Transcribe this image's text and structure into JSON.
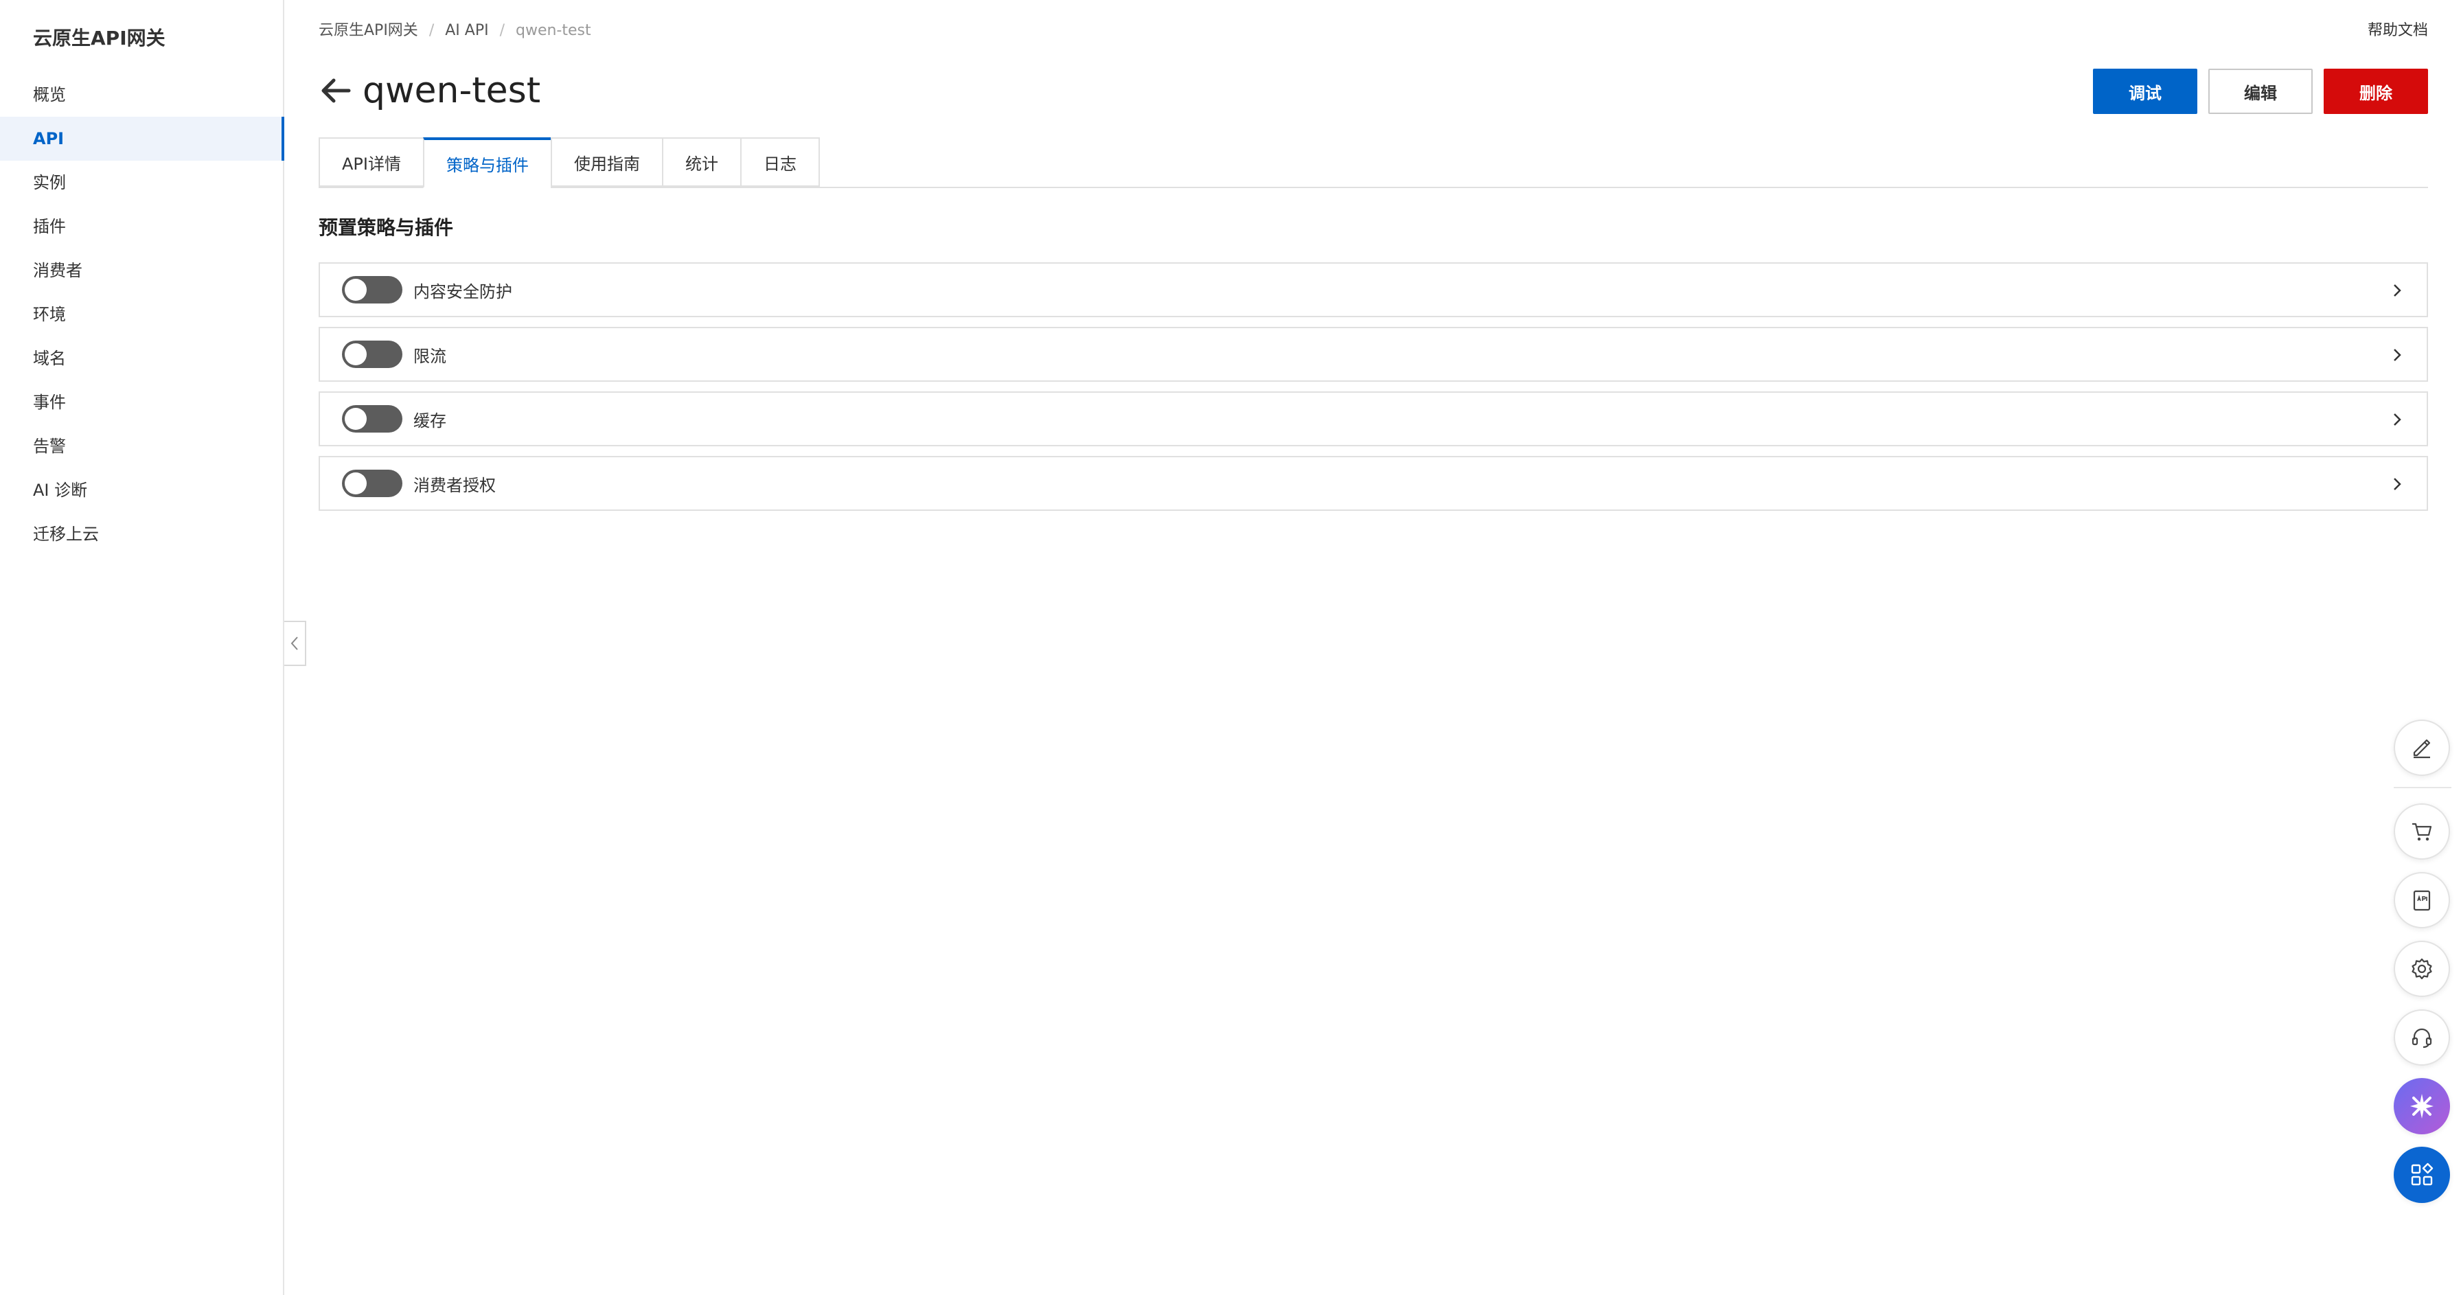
{
  "sidebar": {
    "title": "云原生API网关",
    "items": [
      {
        "label": "概览",
        "active": false
      },
      {
        "label": "API",
        "active": true
      },
      {
        "label": "实例",
        "active": false
      },
      {
        "label": "插件",
        "active": false
      },
      {
        "label": "消费者",
        "active": false
      },
      {
        "label": "环境",
        "active": false
      },
      {
        "label": "域名",
        "active": false
      },
      {
        "label": "事件",
        "active": false
      },
      {
        "label": "告警",
        "active": false
      },
      {
        "label": "AI 诊断",
        "active": false
      },
      {
        "label": "迁移上云",
        "active": false
      }
    ]
  },
  "breadcrumb": [
    "云原生API网关",
    "AI API",
    "qwen-test"
  ],
  "header": {
    "help_label": "帮助文档",
    "title": "qwen-test",
    "debug_label": "调试",
    "edit_label": "编辑",
    "delete_label": "删除"
  },
  "tabs": [
    {
      "label": "API详情",
      "active": false
    },
    {
      "label": "策略与插件",
      "active": true
    },
    {
      "label": "使用指南",
      "active": false
    },
    {
      "label": "统计",
      "active": false
    },
    {
      "label": "日志",
      "active": false
    }
  ],
  "section": {
    "title": "预置策略与插件",
    "items": [
      {
        "label": "内容安全防护",
        "enabled": false
      },
      {
        "label": "限流",
        "enabled": false
      },
      {
        "label": "缓存",
        "enabled": false
      },
      {
        "label": "消费者授权",
        "enabled": false
      }
    ]
  },
  "colors": {
    "primary": "#0064c8",
    "danger": "#d50b0b",
    "switch_off": "#5c5c5c"
  },
  "float_tools": [
    "edit-icon",
    "cart-icon",
    "api-doc-icon",
    "settings-icon",
    "support-headset-icon",
    "ai-assistant-icon",
    "apps-grid-icon"
  ]
}
